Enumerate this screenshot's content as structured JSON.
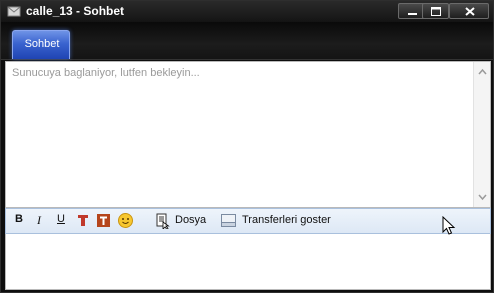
{
  "window": {
    "title": "calle_13 - Sohbet"
  },
  "tabs": [
    {
      "label": "Sohbet",
      "active": true
    }
  ],
  "chat": {
    "status_text": "Sunucuya baglaniyor, lutfen bekleyin..."
  },
  "toolbar": {
    "bold_label": "B",
    "italic_label": "I",
    "underline_label": "U",
    "file_label": "Dosya",
    "transfers_label": "Transferleri goster"
  },
  "colors": {
    "tab_active": "#3a63cf",
    "toolbar_bg": "#dde8f5",
    "status_text": "#9a9a9a"
  }
}
